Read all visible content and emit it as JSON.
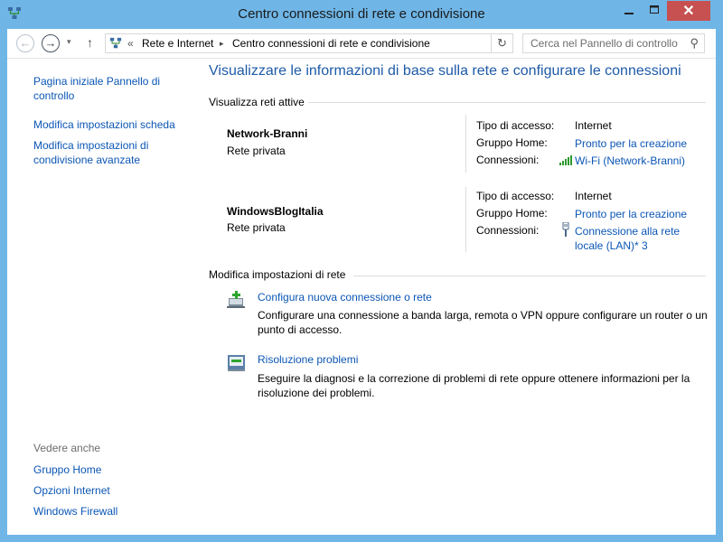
{
  "window": {
    "title": "Centro connessioni di rete e condivisione",
    "close_glyph": "✕",
    "icon": "network-icon"
  },
  "address_bar": {
    "back_glyph": "←",
    "forward_glyph": "→",
    "dropdown_glyph": "▾",
    "up_glyph": "↑",
    "chevron_glyph": "«",
    "crumbs": [
      "Rete e Internet",
      "Centro connessioni di rete e condivisione"
    ],
    "separator_glyph": "▸",
    "refresh_glyph": "↻",
    "search_placeholder": "Cerca nel Pannello di controllo",
    "search_glyph": "⚲"
  },
  "sidebar": {
    "links": [
      "Pagina iniziale Pannello di controllo",
      "Modifica impostazioni scheda",
      "Modifica impostazioni di condivisione avanzate"
    ],
    "see_also_label": "Vedere anche",
    "see_also": [
      "Gruppo Home",
      "Opzioni Internet",
      "Windows Firewall"
    ]
  },
  "main": {
    "heading": "Visualizzare le informazioni di base sulla rete e configurare le connessioni",
    "active_label": "Visualizza reti attive",
    "networks": [
      {
        "name": "Network-Branni",
        "type": "Rete privata",
        "access_label": "Tipo di accesso:",
        "access_value": "Internet",
        "homegroup_label": "Gruppo Home:",
        "homegroup_value": "Pronto per la creazione",
        "connections_label": "Connessioni:",
        "connection_value": "Wi-Fi (Network-Branni)",
        "connection_icon": "wifi-signal-icon"
      },
      {
        "name": "WindowsBlogItalia",
        "type": "Rete privata",
        "access_label": "Tipo di accesso:",
        "access_value": "Internet",
        "homegroup_label": "Gruppo Home:",
        "homegroup_value": "Pronto per la creazione",
        "connections_label": "Connessioni:",
        "connection_value_line1": "Connessione alla rete",
        "connection_value_line2": "locale (LAN)* 3",
        "connection_icon": "ethernet-plug-icon"
      }
    ],
    "change_label": "Modifica impostazioni di rete",
    "tasks": [
      {
        "link": "Configura nuova connessione o rete",
        "desc_line1": "Configurare una connessione a banda larga, remota o VPN oppure configurare un router o un",
        "desc_line2": "punto di accesso.",
        "icon": "new-connection-icon"
      },
      {
        "link": "Risoluzione problemi",
        "desc_line1": "Eseguire la diagnosi e la correzione di problemi di rete oppure ottenere informazioni per la",
        "desc_line2": "risoluzione dei problemi.",
        "icon": "troubleshoot-icon"
      }
    ]
  },
  "colors": {
    "frame": "#6fb6e7",
    "link": "#0b56b5",
    "heading": "#1e5aa8",
    "close_button": "#c75050"
  }
}
